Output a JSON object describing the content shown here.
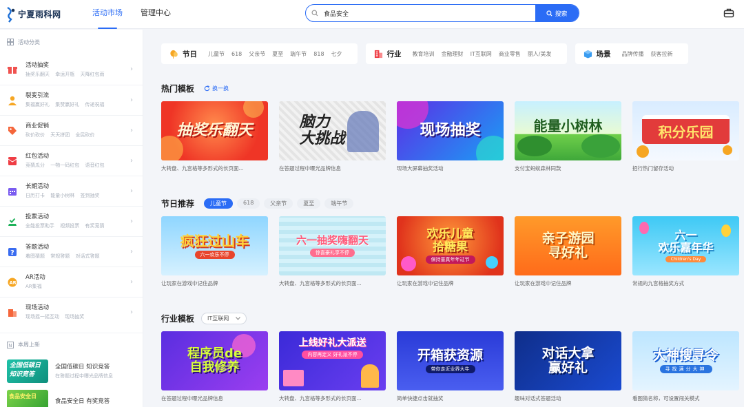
{
  "brand": {
    "name": "宁夏雨科网",
    "accent": "#2b6cf5"
  },
  "nav": [
    {
      "label": "活动市场",
      "active": true
    },
    {
      "label": "管理中心",
      "active": false
    }
  ],
  "search": {
    "value": "食品安全",
    "button": "搜索"
  },
  "sidebar": {
    "header": "活动分类",
    "items": [
      {
        "title": "活动抽奖",
        "sub": "抽奖乐翻天 幸运开瓶 天降红包雨",
        "color": "#f0524f",
        "icon": "gift-icon"
      },
      {
        "title": "裂变引流",
        "sub": "集福赢好礼 集赞赢好礼 传递祝福",
        "color": "#f6a623",
        "icon": "user-icon"
      },
      {
        "title": "商业促销",
        "sub": "砍价砍价 天天拼团 全民砍价",
        "color": "#f5663b",
        "icon": "tag-icon"
      },
      {
        "title": "红包活动",
        "sub": "竞猜瓜分 一物一码红包 语音红包",
        "color": "#ef3e45",
        "icon": "envelope-icon"
      },
      {
        "title": "长期活动",
        "sub": "日历打卡 能量小树林 签到抽奖",
        "color": "#7a5cf0",
        "icon": "calendar-icon"
      },
      {
        "title": "投票活动",
        "sub": "全能投票助手 视频投票 有奖竞猜",
        "color": "#1fb25a",
        "icon": "vote-icon"
      },
      {
        "title": "答题活动",
        "sub": "着图猜题 常规答题 对话式答题",
        "color": "#3a6cf0",
        "icon": "question-icon"
      },
      {
        "title": "AR活动",
        "sub": "AR集福",
        "color": "#f6a623",
        "icon": "ar-icon"
      },
      {
        "title": "现场活动",
        "sub": "现场摇一摇互动 现场抽奖",
        "color": "#f5663b",
        "icon": "stage-icon"
      }
    ],
    "new_header": "本周上新",
    "new_items": [
      {
        "title": "全国低碳日 知识竞答",
        "sub": "在答题过程中曝光品牌信息",
        "thumb_text": "全国低碳日知识竞答"
      },
      {
        "title": "食品安全日 有奖竞答",
        "sub": "",
        "thumb_text": "食品安全日"
      }
    ]
  },
  "categories": [
    {
      "title": "节日",
      "tags": [
        "儿童节",
        "618",
        "父亲节",
        "夏至",
        "端午节",
        "818",
        "七夕"
      ],
      "color": "#f6a623",
      "icon": "balloon-icon"
    },
    {
      "title": "行业",
      "tags": [
        "教育培训",
        "金融理财",
        "IT互联网",
        "商业零售",
        "丽人/美发"
      ],
      "color": "#ef3e45",
      "icon": "building-icon"
    },
    {
      "title": "场景",
      "tags": [
        "品牌传播",
        "获客拉新"
      ],
      "color": "#3a9cf0",
      "icon": "cube-icon"
    }
  ],
  "hot": {
    "title": "热门模板",
    "refresh": "换一换",
    "cards": [
      {
        "art": "抽奖乐翻天",
        "cap": "大转盘、九宫格等多形式的长页面..."
      },
      {
        "art": "脑力\n大挑战",
        "cap": "在答题过程中曝光品牌信息"
      },
      {
        "art": "现场抽奖",
        "cap": "现场大屏幕抽奖活动"
      },
      {
        "art": "能量小树林",
        "cap": "支付宝蚂蚁森林同款"
      },
      {
        "art": "积分乐园",
        "cap": "招行热门留存活动"
      }
    ]
  },
  "festival": {
    "title": "节日推荐",
    "chips": [
      {
        "label": "儿童节",
        "active": true
      },
      {
        "label": "618"
      },
      {
        "label": "父亲节"
      },
      {
        "label": "夏至"
      },
      {
        "label": "端午节"
      }
    ],
    "cards": [
      {
        "art": "疯狂过山车",
        "sub": "六一欢乐不停",
        "cap": "让玩家在游戏中记住品牌"
      },
      {
        "art": "六一抽奖嗨翻天",
        "sub": "惊喜豪礼享不停",
        "cap": "大转盘、九宫格等多形式的长页面..."
      },
      {
        "art": "欢乐儿童\n拾糖果",
        "sub": "保持童真年年过节",
        "cap": "让玩家在游戏中记住品牌"
      },
      {
        "art": "亲子游园\n寻好礼",
        "sub": "",
        "cap": "让玩家在游戏中记住品牌"
      },
      {
        "art": "六一\n欢乐嘉年华",
        "sub": "Children's Day",
        "cap": "常规的九宫格抽奖方式"
      }
    ]
  },
  "industry": {
    "title": "行业模板",
    "select": "IT互联网",
    "cards": [
      {
        "art": "程序员de\n自我修养",
        "sub": "",
        "cap": "在答题过程中曝光品牌信息"
      },
      {
        "art": "上线好礼大派送",
        "sub": "内容再定义 好礼派不停",
        "cap": "大转盘、九宫格等多形式的长页面..."
      },
      {
        "art": "开箱获资源",
        "sub": "带你走近业界大牛",
        "cap": "简单快捷点击就抽奖"
      },
      {
        "art": "对话大拿\n赢好礼",
        "sub": "",
        "cap": "趣味对话式答题活动"
      },
      {
        "art": "大神搜寻令",
        "sub": "寻找满分大神",
        "cap": "看图猜名称，可设置闯关模式"
      }
    ]
  }
}
